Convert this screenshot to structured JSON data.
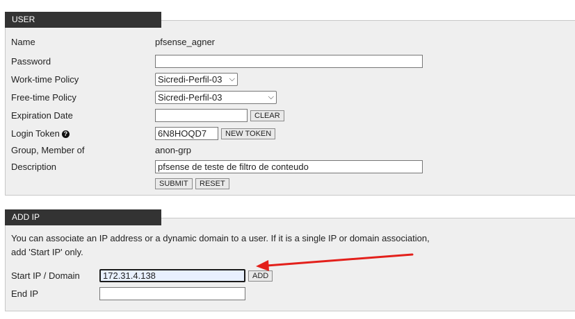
{
  "user_section": {
    "title": "USER",
    "fields": {
      "name_label": "Name",
      "name_value": "pfsense_agner",
      "password_label": "Password",
      "password_value": "",
      "worktime_label": "Work-time Policy",
      "worktime_value": "Sicredi-Perfil-03",
      "freetime_label": "Free-time Policy",
      "freetime_value": "Sicredi-Perfil-03",
      "expiration_label": "Expiration Date",
      "expiration_value": "",
      "clear_button": "CLEAR",
      "token_label": "Login Token",
      "token_value": "6N8HOQD7",
      "new_token_button": "NEW TOKEN",
      "group_label": "Group, Member of",
      "group_value": "anon-grp",
      "description_label": "Description",
      "description_value": "pfsense de teste de filtro de conteudo",
      "submit_button": "SUBMIT",
      "reset_button": "RESET"
    }
  },
  "addip_section": {
    "title": "ADD IP",
    "info_line1": "You can associate an IP address or a dynamic domain to a user. If it is a single IP or domain association,",
    "info_line2": "add 'Start IP' only.",
    "start_ip_label": "Start IP / Domain",
    "start_ip_value": "172.31.4.138",
    "add_button": "ADD",
    "end_ip_label": "End IP",
    "end_ip_value": ""
  },
  "icons": {
    "help": "question-circle-icon",
    "dropdown": "chevron-down-icon",
    "annotation": "red-arrow-icon"
  },
  "colors": {
    "header_bg": "#333333",
    "panel_bg": "#efefef",
    "annotation_arrow": "#e3201b",
    "focus_border": "#1a1a1a"
  }
}
